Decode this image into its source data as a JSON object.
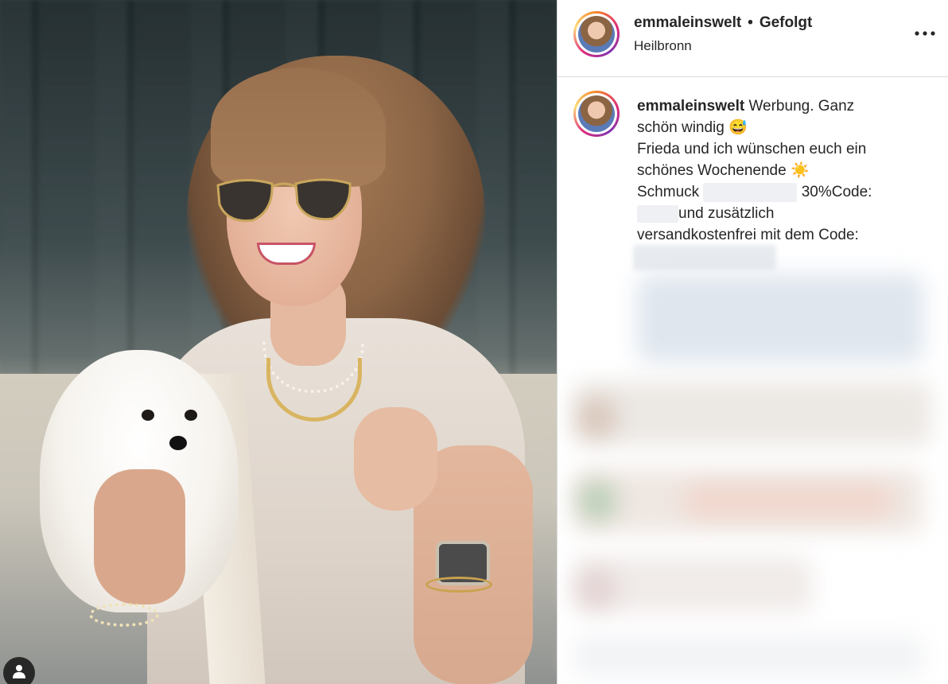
{
  "post": {
    "username": "emmaleinswelt",
    "separator": "•",
    "follow_status": "Gefolgt",
    "location": "Heilbronn",
    "more_icon": "more-horizontal-icon"
  },
  "caption": {
    "username": "emmaleinswelt",
    "line1_text": "Werbung. Ganz",
    "line2_text": "schön windig",
    "line2_emoji": "😅",
    "line3_text": "Frieda und ich wünschen euch ein",
    "line4_text": "schönes Wochenende",
    "line4_emoji": "☀️",
    "line5_prefix": "Schmuck",
    "line5_suffix": "30%Code:",
    "line6_text": "und zusätzlich",
    "line7_text": "versandkostenfrei mit dem Code:"
  },
  "photo": {
    "user_tag_icon": "user-icon"
  },
  "colors": {
    "border": "#dbdbdb",
    "text": "#262626",
    "story_ring": "#dd2a7b"
  }
}
